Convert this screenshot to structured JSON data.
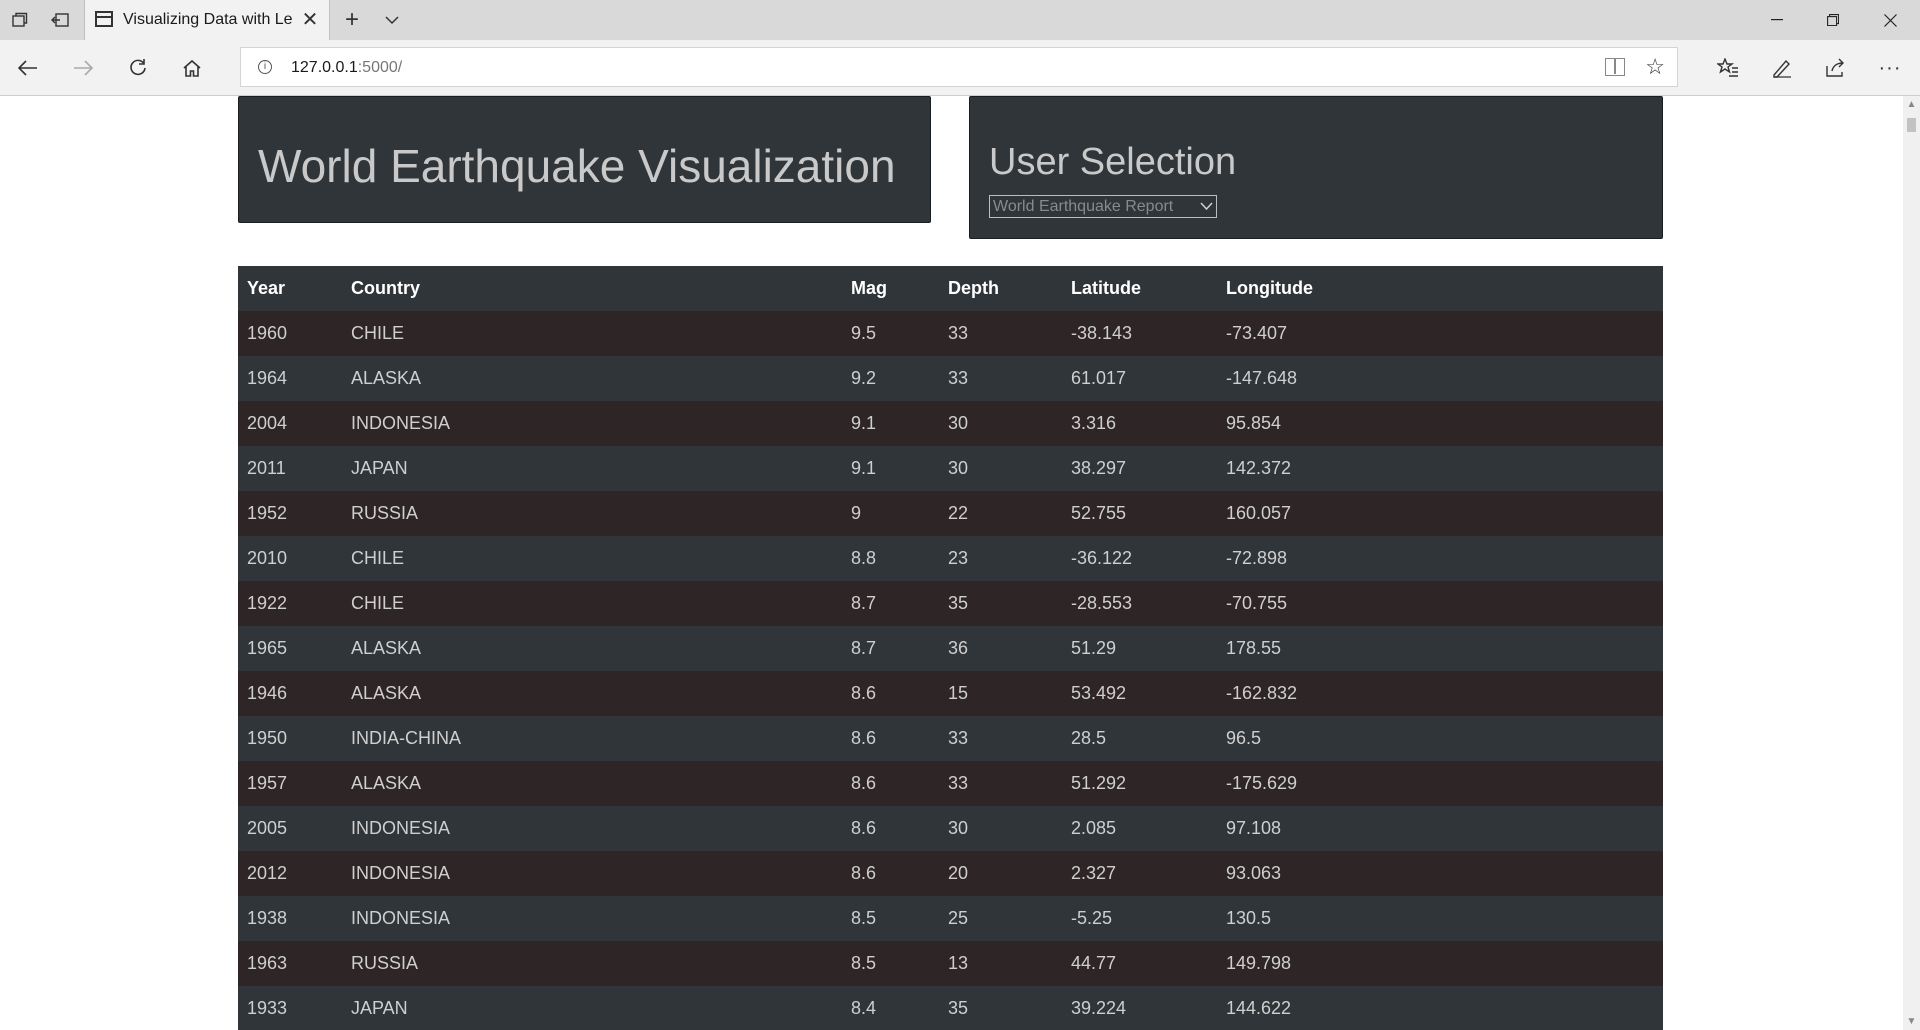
{
  "browser": {
    "tab_title": "Visualizing Data with Le",
    "url_host": "127.0.0.1",
    "url_port": ":5000/"
  },
  "page": {
    "title": "World Earthquake Visualization",
    "selection_heading": "User Selection",
    "selected_report": "World Earthquake Report"
  },
  "table": {
    "headers": [
      "Year",
      "Country",
      "Mag",
      "Depth",
      "Latitude",
      "Longitude"
    ],
    "rows": [
      [
        "1960",
        "CHILE",
        "9.5",
        "33",
        "-38.143",
        "-73.407"
      ],
      [
        "1964",
        "ALASKA",
        "9.2",
        "33",
        "61.017",
        "-147.648"
      ],
      [
        "2004",
        "INDONESIA",
        "9.1",
        "30",
        "3.316",
        "95.854"
      ],
      [
        "2011",
        "JAPAN",
        "9.1",
        "30",
        "38.297",
        "142.372"
      ],
      [
        "1952",
        "RUSSIA",
        "9",
        "22",
        "52.755",
        "160.057"
      ],
      [
        "2010",
        "CHILE",
        "8.8",
        "23",
        "-36.122",
        "-72.898"
      ],
      [
        "1922",
        "CHILE",
        "8.7",
        "35",
        "-28.553",
        "-70.755"
      ],
      [
        "1965",
        "ALASKA",
        "8.7",
        "36",
        "51.29",
        "178.55"
      ],
      [
        "1946",
        "ALASKA",
        "8.6",
        "15",
        "53.492",
        "-162.832"
      ],
      [
        "1950",
        "INDIA-CHINA",
        "8.6",
        "33",
        "28.5",
        "96.5"
      ],
      [
        "1957",
        "ALASKA",
        "8.6",
        "33",
        "51.292",
        "-175.629"
      ],
      [
        "2005",
        "INDONESIA",
        "8.6",
        "30",
        "2.085",
        "97.108"
      ],
      [
        "2012",
        "INDONESIA",
        "8.6",
        "20",
        "2.327",
        "93.063"
      ],
      [
        "1938",
        "INDONESIA",
        "8.5",
        "25",
        "-5.25",
        "130.5"
      ],
      [
        "1963",
        "RUSSIA",
        "8.5",
        "13",
        "44.77",
        "149.798"
      ],
      [
        "1933",
        "JAPAN",
        "8.4",
        "35",
        "39.224",
        "144.622"
      ]
    ]
  },
  "colors": {
    "panel_bg": "#2f3539",
    "row_odd_bg": "#2d2526",
    "row_even_bg": "#2f3539",
    "heading_text": "#c9c9c9"
  }
}
